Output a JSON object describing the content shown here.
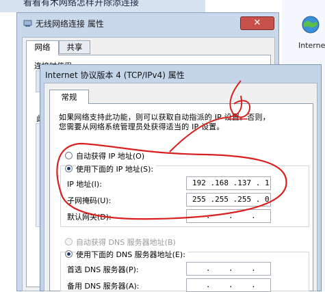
{
  "background": {
    "partial_title": "看看有木网络怎样开除添连接",
    "desktop_icon_label": "Interne"
  },
  "back_window": {
    "title": "无线网络连接 属性",
    "close_glyph": "✕",
    "tabs": [
      {
        "label": "网络",
        "selected": true
      },
      {
        "label": "共享",
        "selected": false
      }
    ],
    "connect_label": "连接时使用:",
    "side_mark": "此"
  },
  "front_window": {
    "title": "Internet 协议版本 4 (TCP/IPv4) 属性",
    "tabs": [
      {
        "label": "常规",
        "selected": true
      }
    ],
    "description": [
      "如果网络支持此功能，则可以获取自动指派的 IP 设置。否则，",
      "您需要从网络系统管理员处获得适当的 IP 设置。"
    ],
    "ip_mode": {
      "auto_label": "自动获得 IP 地址(O)",
      "manual_label": "使用下面的 IP 地址(S):",
      "selected": "manual"
    },
    "ip_fields": [
      {
        "label": "IP 地址(I):",
        "value": "192 .168 .137 . 1"
      },
      {
        "label": "子网掩码(U):",
        "value": "255 .255 .255 . 0"
      },
      {
        "label": "默认网关(D):",
        "value": "   .    .    .  "
      }
    ],
    "dns_mode": {
      "auto_label": "自动获得 DNS 服务器地址(B)",
      "manual_label": "使用下面的 DNS 服务器地址(E):",
      "selected": "manual",
      "auto_disabled": true
    },
    "dns_fields": [
      {
        "label": "首选 DNS 服务器(P):",
        "value": "   .    .    .  "
      },
      {
        "label": "备用 DNS 服务器(A):",
        "value": "   .    .    .  "
      }
    ]
  },
  "annotation": {
    "color": "#d9201f"
  }
}
